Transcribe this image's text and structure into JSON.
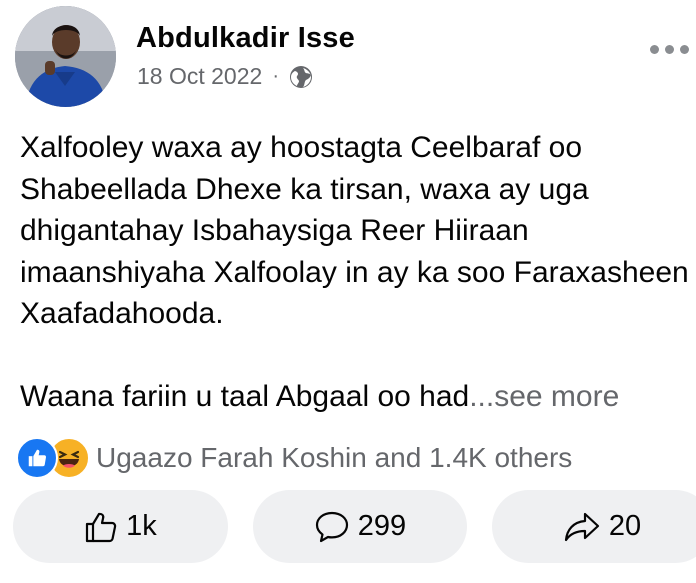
{
  "post": {
    "author": "Abdulkadir Isse",
    "date": "18 Oct 2022",
    "meta_separator": "·",
    "privacy_icon": "globe-icon",
    "body": {
      "paragraph_1": "Xalfooley waxa ay hoostagta Ceelbaraf oo Shabeellada Dhexe ka tirsan, waxa ay uga dhigantahay Isbahaysiga Reer Hiiraan imaanshiyaha Xalfoolay in ay ka soo Faraxasheen Xaafadahooda.",
      "paragraph_2": "Waana fariin u taal Abgaal oo had",
      "see_more": "...see more"
    },
    "reactions": {
      "icons": [
        "like-reaction-icon",
        "haha-reaction-icon"
      ],
      "summary": "Ugaazo Farah Koshin and 1.4K others"
    },
    "actions": {
      "like_count": "1k",
      "comment_count": "299",
      "share_count": "20"
    }
  },
  "colors": {
    "primary_text": "#050505",
    "secondary_text": "#65676b",
    "pill_bg": "#eff0f2",
    "like_blue": "#1877f2",
    "haha_yellow": "#f7b125"
  }
}
